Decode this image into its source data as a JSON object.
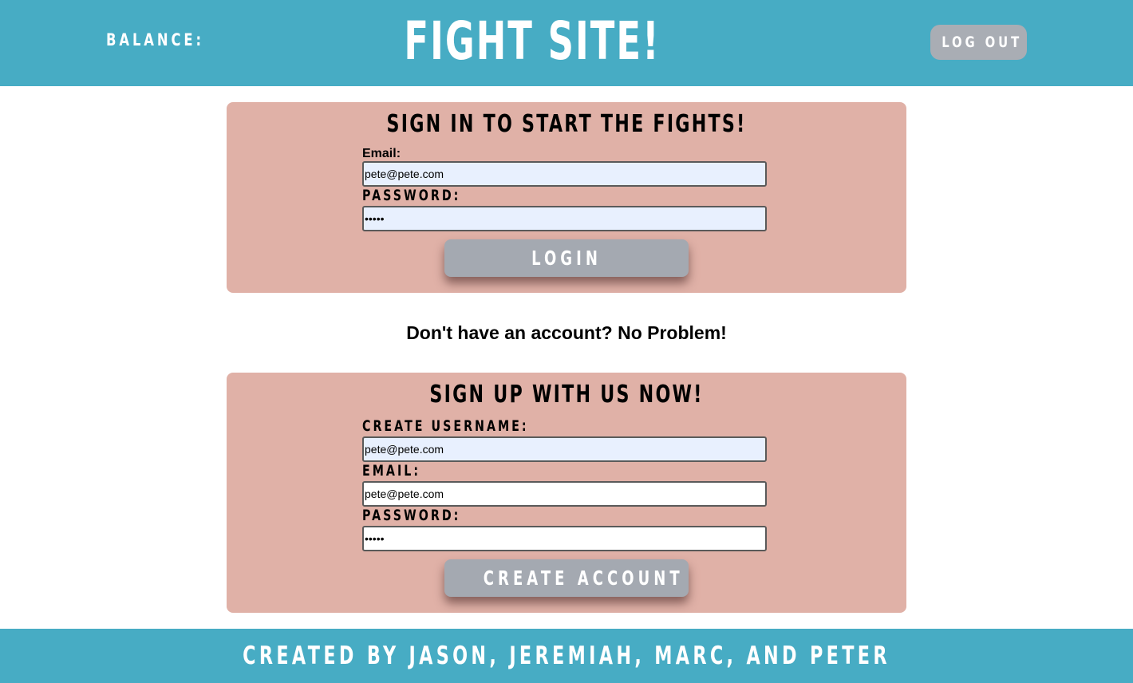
{
  "header": {
    "balance_label": "Balance:",
    "site_title": "Fight Site!",
    "logout_label": "Log Out"
  },
  "signin": {
    "title": "Sign in to start the fights!",
    "email_label": "Email:",
    "email_value": "pete@pete.com",
    "password_label": "Password:",
    "password_value": "peter",
    "submit_label": "Login"
  },
  "account_prompt": "Don't have an account? No Problem!",
  "signup": {
    "title": "Sign up with us now!",
    "username_label": "Create Username:",
    "username_value": "pete@pete.com",
    "email_label": "Email:",
    "email_value": "pete@pete.com",
    "password_label": "Password:",
    "password_value": "peter",
    "submit_label": "Create Account"
  },
  "footer": {
    "credits": "Created by Jason, Jeremiah, Marc, and Peter"
  },
  "colors": {
    "header_bg": "#47acc4",
    "panel_bg": "#e0b1a7",
    "button_bg": "#a4a9b1",
    "autofill_bg": "#e8f0fe"
  }
}
